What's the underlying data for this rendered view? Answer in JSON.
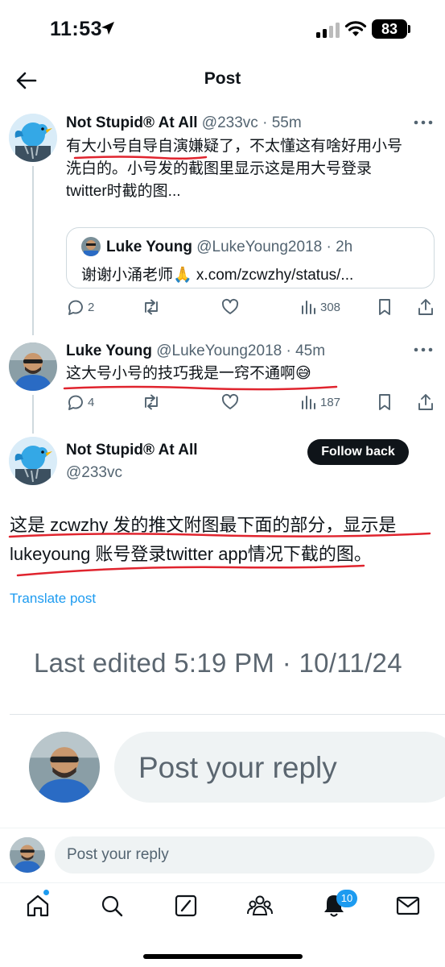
{
  "status_bar": {
    "time": "11:53",
    "battery": "83",
    "icons": [
      "location-arrow-icon",
      "signal-icon",
      "wifi-icon",
      "battery-icon"
    ]
  },
  "header": {
    "title": "Post",
    "back_icon": "arrow-left-icon"
  },
  "tweets": [
    {
      "name": "Not Stupid® At All",
      "handle": "@233vc",
      "time": "55m",
      "text_lines": [
        "有大小号自导自演嫌疑了，不太懂这有啥好用小号",
        "洗白的。小号发的截图里显示这是用大号登录",
        "twitter时截的图..."
      ],
      "quote": {
        "name": "Luke Young",
        "handle": "@LukeYoung2018",
        "time": "2h",
        "text": "谢谢小涌老师🙏 x.com/zcwzhy/status/..."
      },
      "replies": "2",
      "retweets": "",
      "likes": "",
      "views": "308"
    },
    {
      "name": "Luke Young",
      "handle": "@LukeYoung2018",
      "time": "45m",
      "text": "这大号小号的技巧我是一窍不通啊😅",
      "replies": "4",
      "retweets": "",
      "likes": "",
      "views": "187"
    }
  ],
  "main_post": {
    "name": "Not Stupid® At All",
    "handle": "@233vc",
    "follow_label": "Follow back",
    "text_lines": [
      "这是 zcwzhy 发的推文附图最下面的部分，显示是",
      "lukeyoung 账号登录twitter app情况下截的图。"
    ],
    "translate_label": "Translate post"
  },
  "embedded_screenshot": {
    "edited_text": "Last edited 5:19 PM · 10/11/24",
    "reply_placeholder": "Post your reply"
  },
  "reply_bar": {
    "placeholder": "Post your reply"
  },
  "tab_bar": {
    "tabs": [
      "home-icon",
      "search-icon",
      "grok-icon",
      "communities-icon",
      "notifications-icon",
      "messages-icon"
    ],
    "notification_count": "10"
  },
  "colors": {
    "accent": "#1d9bf0",
    "text": "#0f1419",
    "secondary": "#536471",
    "annotation_red": "#e0242e"
  }
}
